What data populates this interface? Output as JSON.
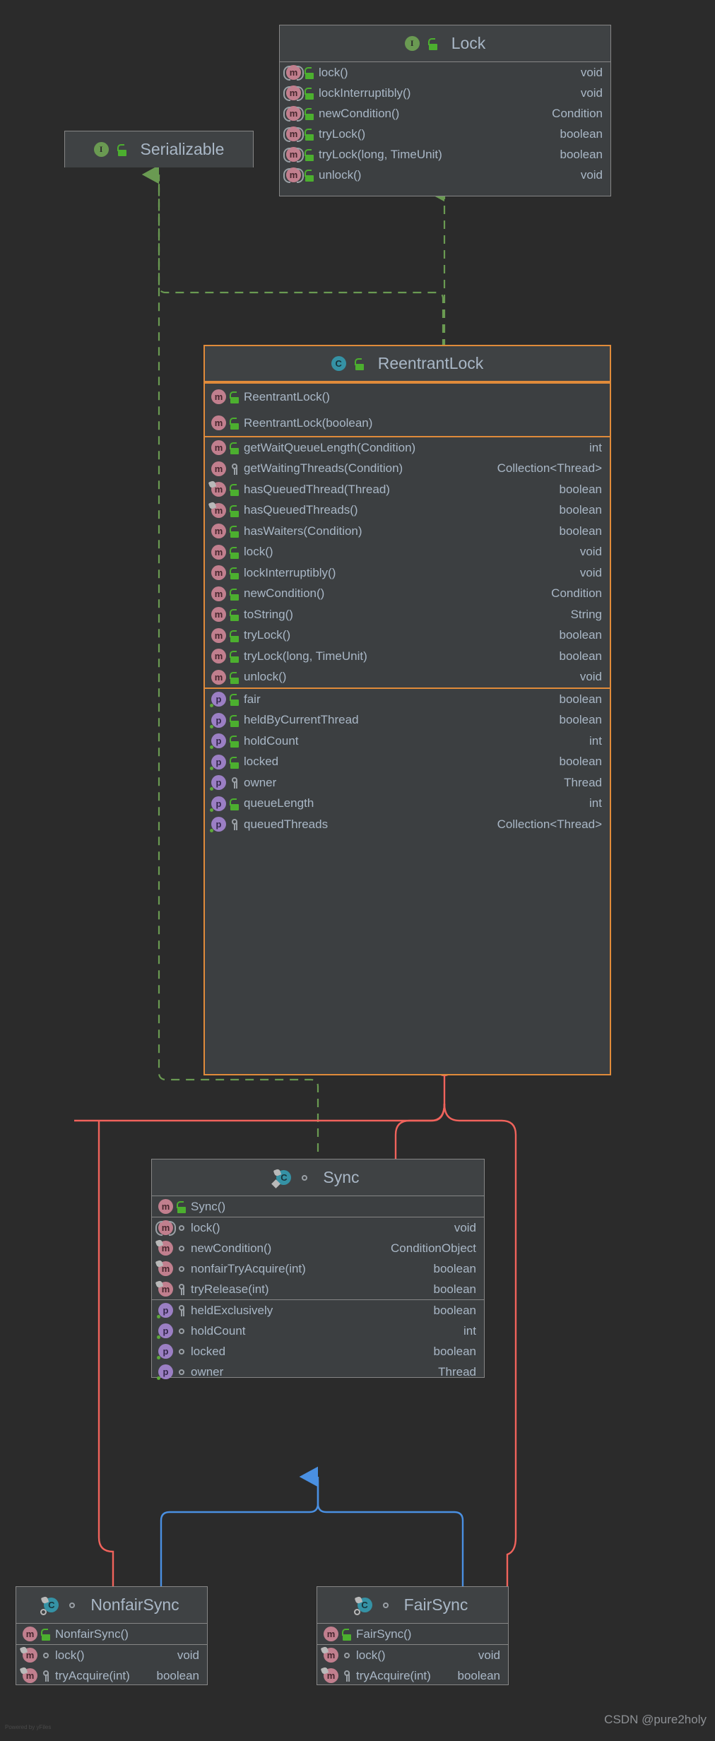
{
  "diagram": {
    "kind": "uml-class-diagram",
    "background": "#2b2b2b",
    "watermark_left": "Powered by yFiles",
    "watermark_right": "CSDN @pure2holy",
    "edge_colors": {
      "implements": "#6a9a52",
      "inner_class": "#f0635c",
      "extends": "#4a90e2",
      "highlight_border": "#e08b3a"
    }
  },
  "classes": {
    "serializable": {
      "name": "Serializable",
      "stereotype": "interface",
      "icon": "interface-icon",
      "visibility": "public",
      "sections": []
    },
    "lock": {
      "name": "Lock",
      "stereotype": "interface",
      "icon": "interface-icon",
      "visibility": "public",
      "methods": [
        {
          "name": "lock()",
          "type": "void",
          "visibility": "public",
          "inherited": true
        },
        {
          "name": "lockInterruptibly()",
          "type": "void",
          "visibility": "public",
          "inherited": true
        },
        {
          "name": "newCondition()",
          "type": "Condition",
          "visibility": "public",
          "inherited": true
        },
        {
          "name": "tryLock()",
          "type": "boolean",
          "visibility": "public",
          "inherited": true
        },
        {
          "name": "tryLock(long, TimeUnit)",
          "type": "boolean",
          "visibility": "public",
          "inherited": true
        },
        {
          "name": "unlock()",
          "type": "void",
          "visibility": "public",
          "inherited": true
        }
      ]
    },
    "reentrantlock": {
      "name": "ReentrantLock",
      "stereotype": "class",
      "icon": "class-icon",
      "visibility": "public",
      "highlighted": true,
      "constructors": [
        {
          "name": "ReentrantLock()",
          "type": "",
          "visibility": "public"
        },
        {
          "name": "ReentrantLock(boolean)",
          "type": "",
          "visibility": "public"
        }
      ],
      "methods": [
        {
          "name": "getWaitQueueLength(Condition)",
          "type": "int",
          "visibility": "public"
        },
        {
          "name": "getWaitingThreads(Condition)",
          "type": "Collection<Thread>",
          "visibility": "protected"
        },
        {
          "name": "hasQueuedThread(Thread)",
          "type": "boolean",
          "visibility": "public",
          "override": true
        },
        {
          "name": "hasQueuedThreads()",
          "type": "boolean",
          "visibility": "public",
          "override": true
        },
        {
          "name": "hasWaiters(Condition)",
          "type": "boolean",
          "visibility": "public"
        },
        {
          "name": "lock()",
          "type": "void",
          "visibility": "public"
        },
        {
          "name": "lockInterruptibly()",
          "type": "void",
          "visibility": "public"
        },
        {
          "name": "newCondition()",
          "type": "Condition",
          "visibility": "public"
        },
        {
          "name": "toString()",
          "type": "String",
          "visibility": "public"
        },
        {
          "name": "tryLock()",
          "type": "boolean",
          "visibility": "public"
        },
        {
          "name": "tryLock(long, TimeUnit)",
          "type": "boolean",
          "visibility": "public"
        },
        {
          "name": "unlock()",
          "type": "void",
          "visibility": "public"
        }
      ],
      "properties": [
        {
          "name": "fair",
          "type": "boolean",
          "visibility": "public"
        },
        {
          "name": "heldByCurrentThread",
          "type": "boolean",
          "visibility": "public"
        },
        {
          "name": "holdCount",
          "type": "int",
          "visibility": "public"
        },
        {
          "name": "locked",
          "type": "boolean",
          "visibility": "public"
        },
        {
          "name": "owner",
          "type": "Thread",
          "visibility": "protected"
        },
        {
          "name": "queueLength",
          "type": "int",
          "visibility": "public"
        },
        {
          "name": "queuedThreads",
          "type": "Collection<Thread>",
          "visibility": "protected"
        }
      ]
    },
    "sync": {
      "name": "Sync",
      "stereotype": "abstract class",
      "icon": "abstract-class-icon",
      "visibility": "package-private",
      "constructors": [
        {
          "name": "Sync()",
          "type": "",
          "visibility": "public"
        }
      ],
      "methods": [
        {
          "name": "lock()",
          "type": "void",
          "visibility": "package-private",
          "inherited": true
        },
        {
          "name": "newCondition()",
          "type": "ConditionObject",
          "visibility": "package-private",
          "override": true
        },
        {
          "name": "nonfairTryAcquire(int)",
          "type": "boolean",
          "visibility": "package-private",
          "override": true
        },
        {
          "name": "tryRelease(int)",
          "type": "boolean",
          "visibility": "protected",
          "override": true
        }
      ],
      "properties": [
        {
          "name": "heldExclusively",
          "type": "boolean",
          "visibility": "protected"
        },
        {
          "name": "holdCount",
          "type": "int",
          "visibility": "package-private"
        },
        {
          "name": "locked",
          "type": "boolean",
          "visibility": "package-private"
        },
        {
          "name": "owner",
          "type": "Thread",
          "visibility": "package-private"
        }
      ]
    },
    "nonfairsync": {
      "name": "NonfairSync",
      "stereotype": "final class",
      "icon": "final-class-icon",
      "visibility": "package-private",
      "constructors": [
        {
          "name": "NonfairSync()",
          "type": "",
          "visibility": "public"
        }
      ],
      "methods": [
        {
          "name": "lock()",
          "type": "void",
          "visibility": "package-private",
          "override": true
        },
        {
          "name": "tryAcquire(int)",
          "type": "boolean",
          "visibility": "protected",
          "override": true
        }
      ]
    },
    "fairsync": {
      "name": "FairSync",
      "stereotype": "final class",
      "icon": "final-class-icon",
      "visibility": "package-private",
      "constructors": [
        {
          "name": "FairSync()",
          "type": "",
          "visibility": "public"
        }
      ],
      "methods": [
        {
          "name": "lock()",
          "type": "void",
          "visibility": "package-private",
          "override": true
        },
        {
          "name": "tryAcquire(int)",
          "type": "boolean",
          "visibility": "protected",
          "override": true
        }
      ]
    }
  },
  "relations": [
    {
      "from": "ReentrantLock",
      "to": "Lock",
      "type": "implements",
      "style": "dashed-green"
    },
    {
      "from": "ReentrantLock",
      "to": "Serializable",
      "type": "implements",
      "style": "dashed-green"
    },
    {
      "from": "Sync",
      "to": "Serializable",
      "type": "implements",
      "style": "dashed-green"
    },
    {
      "from": "Sync",
      "to": "ReentrantLock",
      "type": "inner-class",
      "style": "solid-red",
      "marker": "plus"
    },
    {
      "from": "NonfairSync",
      "to": "ReentrantLock",
      "type": "inner-class",
      "style": "solid-red"
    },
    {
      "from": "FairSync",
      "to": "ReentrantLock",
      "type": "inner-class",
      "style": "solid-red"
    },
    {
      "from": "NonfairSync",
      "to": "Sync",
      "type": "extends",
      "style": "solid-blue"
    },
    {
      "from": "FairSync",
      "to": "Sync",
      "type": "extends",
      "style": "solid-blue"
    }
  ],
  "icon_glyphs": {
    "interface": "I",
    "class": "C",
    "method": "m",
    "property": "p",
    "plus": "+"
  }
}
